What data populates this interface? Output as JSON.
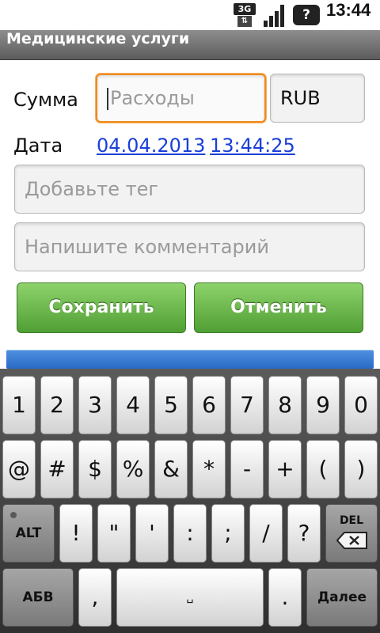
{
  "status_bar": {
    "network": "3G",
    "time": "13:44"
  },
  "title": "Медицинские услуги",
  "form": {
    "amount_label": "Сумма",
    "amount_placeholder": "Расходы",
    "currency": "RUB",
    "date_label": "Дата",
    "date_value": "04.04.2013",
    "time_value": "13:44:25",
    "tag_placeholder": "Добавьте тег",
    "comment_placeholder": "Напишите комментарий",
    "save_label": "Сохранить",
    "cancel_label": "Отменить"
  },
  "keyboard": {
    "row1": [
      "1",
      "2",
      "3",
      "4",
      "5",
      "6",
      "7",
      "8",
      "9",
      "0"
    ],
    "row2": [
      "@",
      "#",
      "$",
      "%",
      "&",
      "*",
      "-",
      "+",
      "(",
      ")"
    ],
    "row3": [
      "ALT",
      "!",
      "\"",
      "'",
      ":",
      ";",
      "/",
      "?",
      "DEL"
    ],
    "row4": [
      "АБВ",
      ",",
      "␣",
      ".",
      "Далее"
    ]
  }
}
